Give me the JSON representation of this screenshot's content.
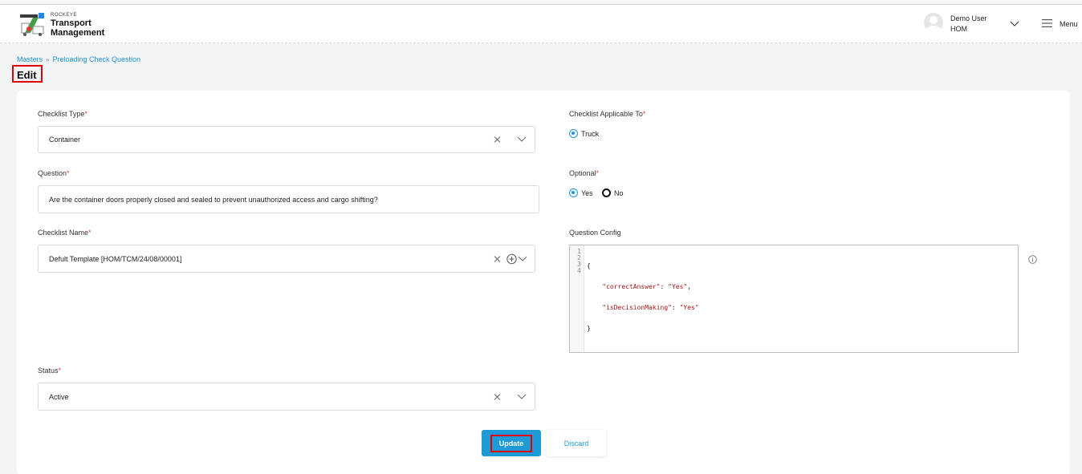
{
  "header": {
    "brand_small": "ROCKEYE",
    "brand_line1": "Transport",
    "brand_line2": "Management",
    "user_name": "Demo User",
    "user_branch": "HOM",
    "menu_label": "Menu"
  },
  "breadcrumb": {
    "root": "Masters",
    "current": "Preloading Check Question"
  },
  "page_title": "Edit",
  "form": {
    "checklist_type": {
      "label": "Checklist Type",
      "required": "*",
      "value": "Container"
    },
    "question": {
      "label": "Question",
      "required": "*",
      "value": "Are the container doors properly closed and sealed to prevent unauthorized access and cargo shifting?"
    },
    "checklist_name": {
      "label": "Checklist Name",
      "required": "*",
      "value": "Defult Template [HOM/TCM/24/08/00001]"
    },
    "status": {
      "label": "Status",
      "required": "*",
      "value": "Active"
    },
    "applicable_to": {
      "label": "Checklist Applicable To",
      "required": "*",
      "option": "Truck"
    },
    "optional": {
      "label": "Optional",
      "required": "*",
      "yes": "Yes",
      "no": "No"
    },
    "question_config": {
      "label": "Question Config",
      "line_numbers": [
        "1",
        "2",
        "3",
        "4"
      ],
      "open": "{",
      "key1": "\"correctAnswer\"",
      "val1": "\"Yes\"",
      "key2": "\"isDecisionMaking\"",
      "val2": "\"Yes\"",
      "close": "}"
    }
  },
  "buttons": {
    "update": "Update",
    "discard": "Discard"
  },
  "colors": {
    "accent": "#1e9ad6",
    "highlight": "#e00000",
    "required": "#e53935"
  }
}
